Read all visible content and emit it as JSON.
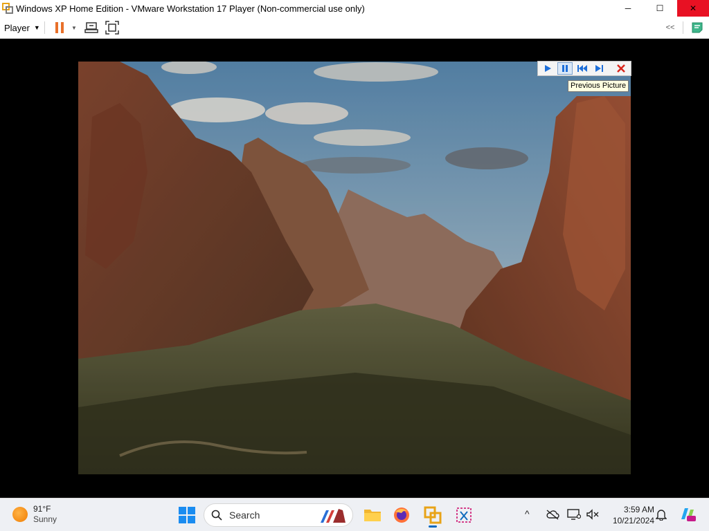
{
  "window": {
    "title": "Windows XP Home Edition - VMware Workstation 17 Player (Non-commercial use only)",
    "minimize_glyph": "─",
    "maximize_glyph": "☐",
    "close_glyph": "✕"
  },
  "toolbar": {
    "player_label": "Player",
    "player_caret": "▼",
    "pause_caret": "▼",
    "collapse_glyph": "<<"
  },
  "viewer": {
    "buttons": [
      "play-slideshow",
      "pause-slideshow",
      "previous-picture",
      "next-picture",
      "close-slideshow"
    ],
    "active_button": "pause-slideshow",
    "tooltip": "Previous Picture",
    "picture_description_icon": "zion-canyon-photo"
  },
  "taskbar": {
    "weather": {
      "temp": "91°F",
      "condition": "Sunny",
      "icon": "sun-icon"
    },
    "search_placeholder": "Search",
    "apps": [
      "file-explorer",
      "firefox",
      "vmware-workstation-player",
      "snipping-tool"
    ],
    "active_app": "vmware-workstation-player",
    "tray_up_glyph": "^",
    "clock": {
      "time": "3:59 AM",
      "date": "10/21/2024"
    }
  },
  "colors": {
    "pause_orange": "#e8702a",
    "close_red": "#e81123",
    "taskbar_bg": "#eef0f4",
    "accent_blue": "#0067c0",
    "viewer_blue": "#1e6fd9",
    "viewer_close_red": "#d9261c"
  }
}
